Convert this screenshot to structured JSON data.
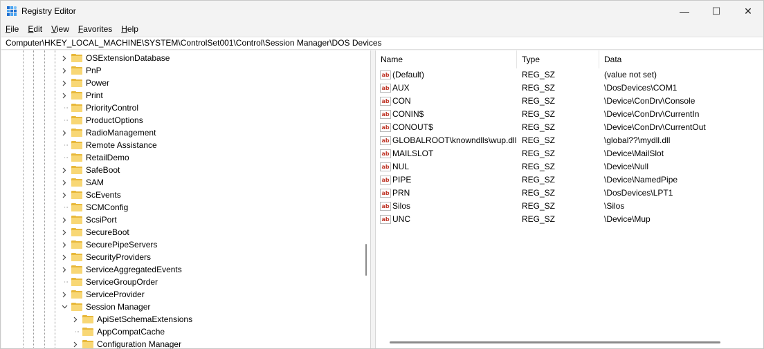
{
  "window": {
    "title": "Registry Editor"
  },
  "title_buttons": {
    "minimize": "—",
    "maximize": "☐",
    "close": "✕"
  },
  "menu": [
    {
      "u": "F",
      "rest": "ile"
    },
    {
      "u": "E",
      "rest": "dit"
    },
    {
      "u": "V",
      "rest": "iew"
    },
    {
      "u": "F",
      "rest": "avorites"
    },
    {
      "u": "H",
      "rest": "elp"
    }
  ],
  "address": "Computer\\HKEY_LOCAL_MACHINE\\SYSTEM\\ControlSet001\\Control\\Session Manager\\DOS Devices",
  "tree": [
    {
      "label": "OSExtensionDatabase",
      "expand": true,
      "level": 0
    },
    {
      "label": "PnP",
      "expand": true,
      "level": 0
    },
    {
      "label": "Power",
      "expand": true,
      "level": 0
    },
    {
      "label": "Print",
      "expand": true,
      "level": 0
    },
    {
      "label": "PriorityControl",
      "expand": false,
      "level": 0
    },
    {
      "label": "ProductOptions",
      "expand": false,
      "level": 0
    },
    {
      "label": "RadioManagement",
      "expand": true,
      "level": 0
    },
    {
      "label": "Remote Assistance",
      "expand": false,
      "level": 0
    },
    {
      "label": "RetailDemo",
      "expand": false,
      "level": 0
    },
    {
      "label": "SafeBoot",
      "expand": true,
      "level": 0
    },
    {
      "label": "SAM",
      "expand": true,
      "level": 0
    },
    {
      "label": "ScEvents",
      "expand": true,
      "level": 0
    },
    {
      "label": "SCMConfig",
      "expand": false,
      "level": 0
    },
    {
      "label": "ScsiPort",
      "expand": true,
      "level": 0
    },
    {
      "label": "SecureBoot",
      "expand": true,
      "level": 0
    },
    {
      "label": "SecurePipeServers",
      "expand": true,
      "level": 0
    },
    {
      "label": "SecurityProviders",
      "expand": true,
      "level": 0
    },
    {
      "label": "ServiceAggregatedEvents",
      "expand": true,
      "level": 0
    },
    {
      "label": "ServiceGroupOrder",
      "expand": false,
      "level": 0
    },
    {
      "label": "ServiceProvider",
      "expand": true,
      "level": 0
    },
    {
      "label": "Session Manager",
      "expand": "open",
      "level": 0
    },
    {
      "label": "ApiSetSchemaExtensions",
      "expand": true,
      "level": 1
    },
    {
      "label": "AppCompatCache",
      "expand": false,
      "level": 1
    },
    {
      "label": "Configuration Manager",
      "expand": true,
      "level": 1
    }
  ],
  "list": {
    "headers": [
      "Name",
      "Type",
      "Data"
    ],
    "rows": [
      {
        "name": "(Default)",
        "type": "REG_SZ",
        "data": "(value not set)"
      },
      {
        "name": "AUX",
        "type": "REG_SZ",
        "data": "\\DosDevices\\COM1"
      },
      {
        "name": "CON",
        "type": "REG_SZ",
        "data": "\\Device\\ConDrv\\Console"
      },
      {
        "name": "CONIN$",
        "type": "REG_SZ",
        "data": "\\Device\\ConDrv\\CurrentIn"
      },
      {
        "name": "CONOUT$",
        "type": "REG_SZ",
        "data": "\\Device\\ConDrv\\CurrentOut"
      },
      {
        "name": "GLOBALROOT\\knowndlls\\wup.dll",
        "type": "REG_SZ",
        "data": "\\global??\\mydll.dll"
      },
      {
        "name": "MAILSLOT",
        "type": "REG_SZ",
        "data": "\\Device\\MailSlot"
      },
      {
        "name": "NUL",
        "type": "REG_SZ",
        "data": "\\Device\\Null"
      },
      {
        "name": "PIPE",
        "type": "REG_SZ",
        "data": "\\Device\\NamedPipe"
      },
      {
        "name": "PRN",
        "type": "REG_SZ",
        "data": "\\DosDevices\\LPT1"
      },
      {
        "name": "Silos",
        "type": "REG_SZ",
        "data": "\\Silos"
      },
      {
        "name": "UNC",
        "type": "REG_SZ",
        "data": "\\Device\\Mup"
      }
    ],
    "value_icon_text": "ab"
  }
}
